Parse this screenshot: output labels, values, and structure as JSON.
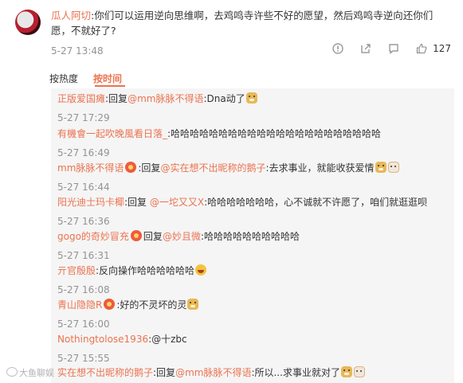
{
  "comment": {
    "author": "瓜人阿切",
    "text": ":你们可以运用逆向思维啊，去鸡鸣寺许些不好的愿望，然后鸡鸣寺逆向还你们愿，不就好了?",
    "time": "5-27 13:48",
    "like_count": "127"
  },
  "sort": {
    "hot": "按热度",
    "time": "按时间"
  },
  "replies": [
    {
      "name": "正版爱国瘫",
      "pre": ":回复",
      "mention": "@mm脉脉不得语",
      "text": ":Dna动了",
      "time": "5-27 17:29"
    },
    {
      "name": "有機會一起吹晚風看日落_",
      "text": ":哈哈哈哈哈哈哈哈哈哈哈哈哈哈哈哈哈哈哈哈哈哈",
      "time": "5-27 16:49"
    },
    {
      "name": "mm脉脉不得语",
      "pre": ":回复",
      "mention": "@实在想不出昵称的鹅子",
      "text": ":去求事业，就能收获爱情",
      "time": "5-27 16:44"
    },
    {
      "name": "阳光迪士玛卡椰",
      "pre": ":回复 ",
      "mention": "@一坨又又X",
      "text": ":哈哈哈哈哈哈哈，心不诚就不许愿了，咱们就逛逛呗",
      "time": "5-27 16:36"
    },
    {
      "name": "gogo的奇妙冒充",
      "pre": "回复",
      "mention": "@妙且微",
      "text": ":哈哈哈哈哈哈哈哈哈哈",
      "time": "5-27 16:31"
    },
    {
      "name": "亓官殷殷",
      "text": ":反向操作哈哈哈哈哈哈",
      "time": "5-27 16:08"
    },
    {
      "name": "青山隐隐R",
      "text": ":好的不灵坏的灵",
      "time": "5-27 16:00"
    },
    {
      "name": "Nothingtolose1936",
      "text": ":@十zbc",
      "time": "5-27 15:55"
    },
    {
      "name": "实在想不出昵称的鹅子",
      "pre": ":回复",
      "mention": "@mm脉脉不得语",
      "text": ":所以...求事业就对了"
    }
  ],
  "watermark": "大鱼聊娱",
  "icons": [
    "warning-icon",
    "share-icon",
    "comment-icon",
    "like-icon",
    "doge-emoji",
    "cat-emoji",
    "laugh-emoji",
    "user-badge-icon"
  ],
  "colors": {
    "accent": "#eb7350",
    "muted": "#939393",
    "reply_bg": "#f5f5f5"
  }
}
